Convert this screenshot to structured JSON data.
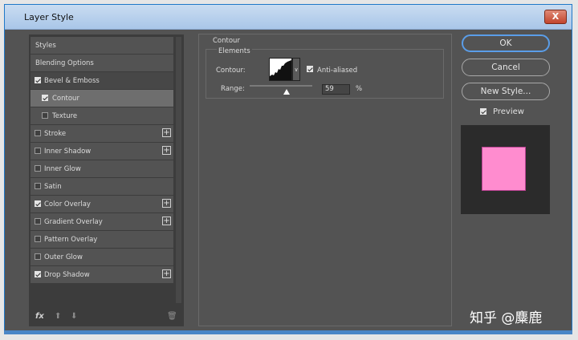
{
  "window": {
    "title": "Layer Style",
    "close_label": "X"
  },
  "left_panel": {
    "items": [
      {
        "label": "Styles",
        "checkbox": false,
        "checked": false,
        "plus": false
      },
      {
        "label": "Blending Options",
        "checkbox": false,
        "checked": false,
        "plus": false
      },
      {
        "label": "Bevel & Emboss",
        "checkbox": true,
        "checked": true,
        "plus": false
      },
      {
        "label": "Contour",
        "checkbox": true,
        "checked": true,
        "plus": false
      },
      {
        "label": "Texture",
        "checkbox": true,
        "checked": false,
        "plus": false
      },
      {
        "label": "Stroke",
        "checkbox": true,
        "checked": false,
        "plus": true
      },
      {
        "label": "Inner Shadow",
        "checkbox": true,
        "checked": false,
        "plus": true
      },
      {
        "label": "Inner Glow",
        "checkbox": true,
        "checked": false,
        "plus": false
      },
      {
        "label": "Satin",
        "checkbox": true,
        "checked": false,
        "plus": false
      },
      {
        "label": "Color Overlay",
        "checkbox": true,
        "checked": true,
        "plus": true
      },
      {
        "label": "Gradient Overlay",
        "checkbox": true,
        "checked": false,
        "plus": true
      },
      {
        "label": "Pattern Overlay",
        "checkbox": true,
        "checked": false,
        "plus": false
      },
      {
        "label": "Outer Glow",
        "checkbox": true,
        "checked": false,
        "plus": false
      },
      {
        "label": "Drop Shadow",
        "checkbox": true,
        "checked": true,
        "plus": true
      }
    ],
    "plus_glyph": "+",
    "bottom_icons": {
      "fx": "fx",
      "up": "⬆",
      "down": "⬇",
      "trash": "🗑"
    }
  },
  "contour_panel": {
    "section_title": "Contour",
    "group_title": "Elements",
    "contour_label": "Contour:",
    "dropdown_glyph": "∨",
    "antialiased_label": "Anti-aliased",
    "antialiased_checked": true,
    "range_label": "Range:",
    "range_value": "59",
    "range_unit": "%",
    "range_percent": 59
  },
  "buttons": {
    "ok": "OK",
    "cancel": "Cancel",
    "new_style": "New Style..."
  },
  "preview": {
    "label": "Preview",
    "checked": true,
    "swatch_color": "#ff8ccf"
  },
  "watermark": "知乎 @麋鹿"
}
